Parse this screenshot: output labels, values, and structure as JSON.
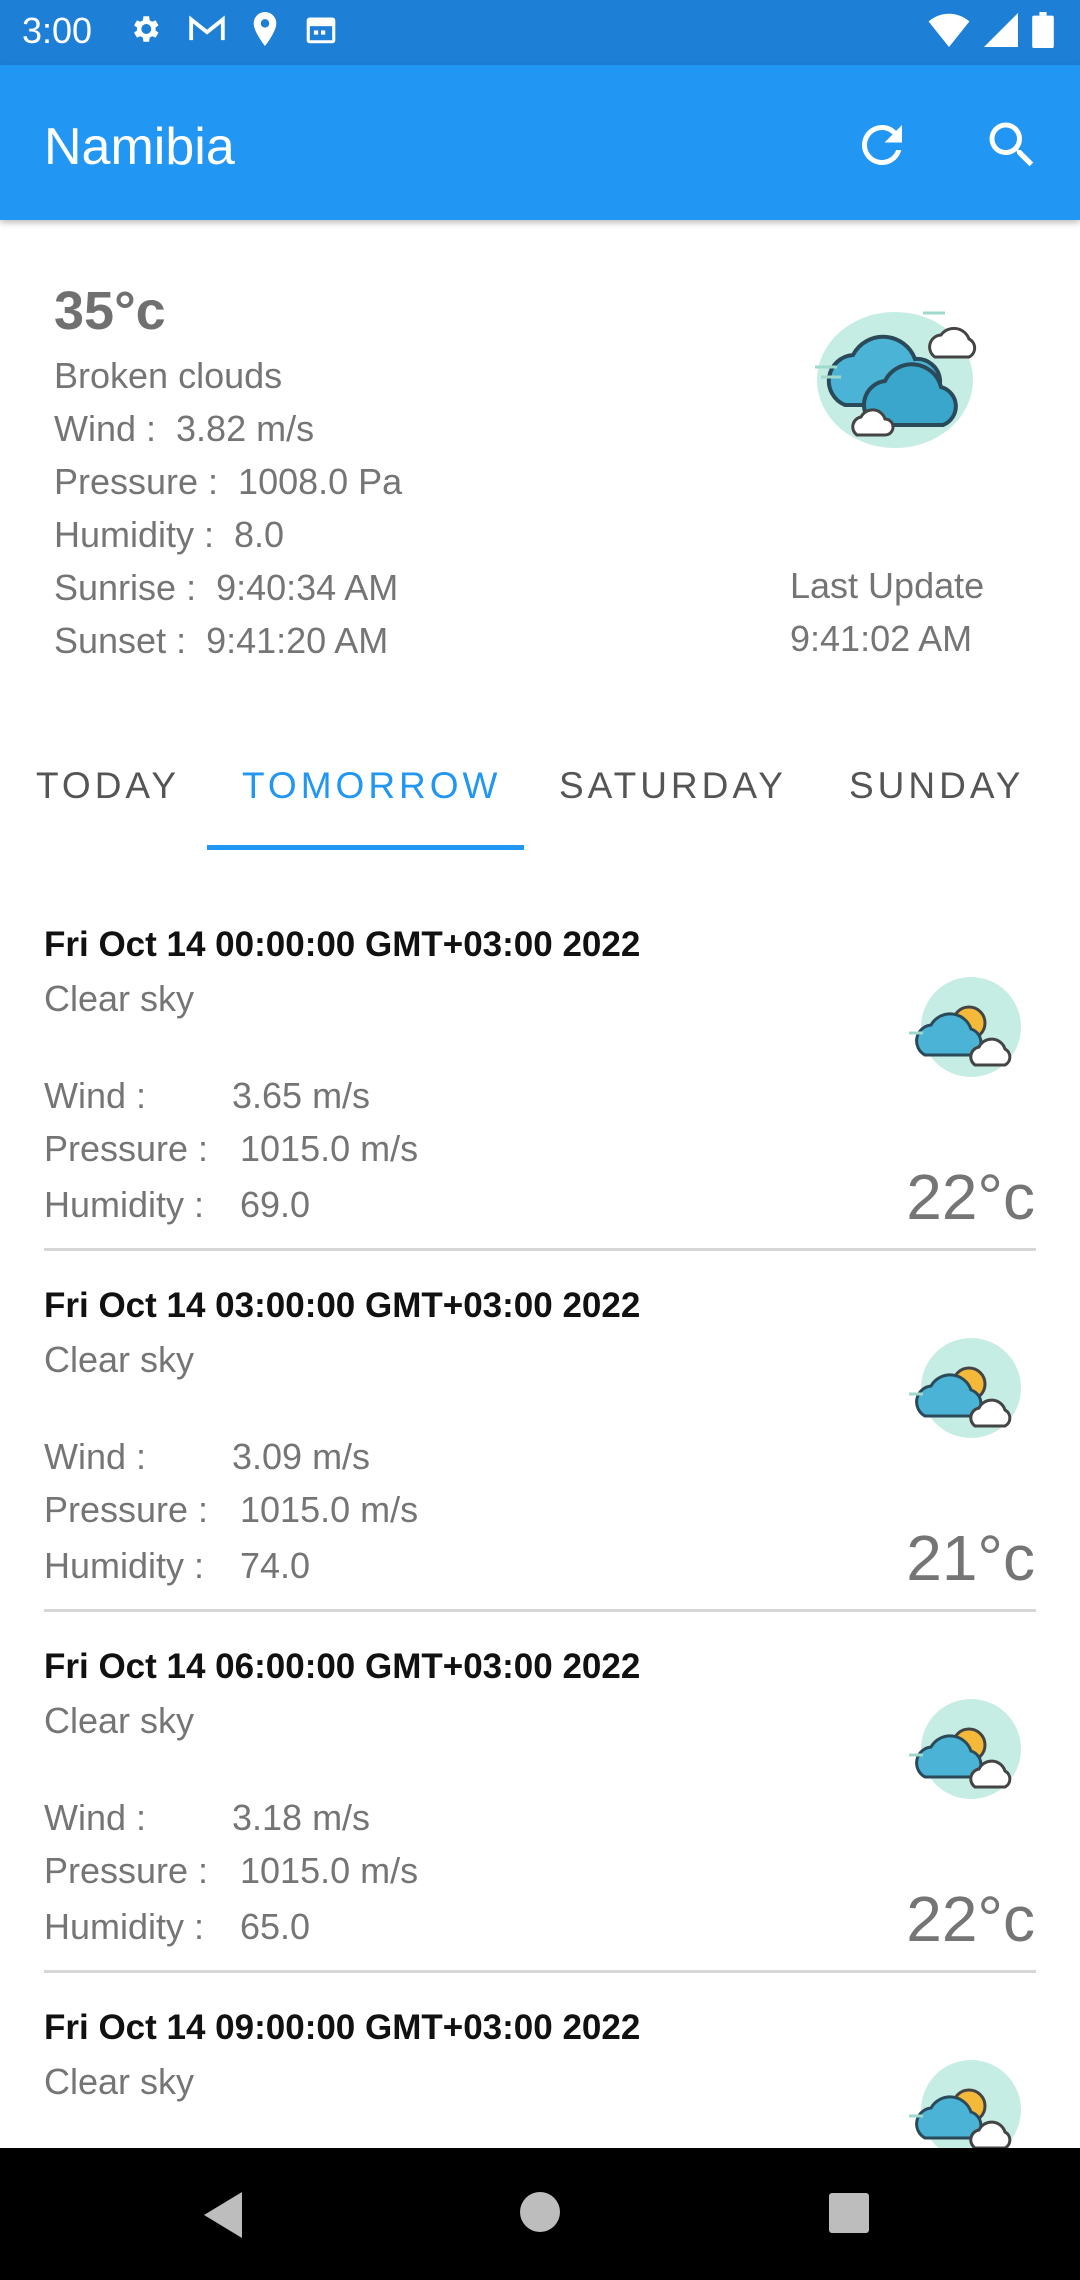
{
  "status_bar": {
    "time": "3:00",
    "icons_left": [
      "settings-icon",
      "gmail-icon",
      "location-icon",
      "calendar-icon"
    ],
    "icons_right": [
      "wifi-icon",
      "signal-icon",
      "battery-icon"
    ]
  },
  "app_bar": {
    "title": "Namibia",
    "actions": [
      "refresh-icon",
      "search-icon"
    ],
    "color": "#2196f3"
  },
  "current": {
    "temperature": "35°c",
    "description": "Broken clouds",
    "wind": "Wind :  3.82 m/s",
    "pressure": "Pressure :  1008.0 Pa",
    "humidity": "Humidity :  8.0",
    "sunrise": "Sunrise :  9:40:34 AM",
    "sunset": "Sunset :  9:41:20 AM",
    "last_update_label": "Last Update",
    "last_update_time": "9:41:02 AM",
    "icon": "broken-clouds-icon"
  },
  "tabs": [
    {
      "label": "TODAY",
      "active": false
    },
    {
      "label": "TOMORROW",
      "active": true
    },
    {
      "label": "SATURDAY",
      "active": false
    },
    {
      "label": "SUNDAY",
      "active": false
    }
  ],
  "forecast": [
    {
      "date": "Fri Oct 14 00:00:00 GMT+03:00 2022",
      "description": "Clear sky",
      "wind_label": "Wind :",
      "wind": "3.65 m/s",
      "pressure_label": "Pressure :",
      "pressure": "1015.0 m/s",
      "humidity_label": "Humidity :",
      "humidity": "69.0",
      "temperature": "22°c",
      "icon": "partly-cloudy-icon"
    },
    {
      "date": "Fri Oct 14 03:00:00 GMT+03:00 2022",
      "description": "Clear sky",
      "wind_label": "Wind :",
      "wind": "3.09 m/s",
      "pressure_label": "Pressure :",
      "pressure": "1015.0 m/s",
      "humidity_label": "Humidity :",
      "humidity": "74.0",
      "temperature": "21°c",
      "icon": "partly-cloudy-icon"
    },
    {
      "date": "Fri Oct 14 06:00:00 GMT+03:00 2022",
      "description": "Clear sky",
      "wind_label": "Wind :",
      "wind": "3.18 m/s",
      "pressure_label": "Pressure :",
      "pressure": "1015.0 m/s",
      "humidity_label": "Humidity :",
      "humidity": "65.0",
      "temperature": "22°c",
      "icon": "partly-cloudy-icon"
    },
    {
      "date": "Fri Oct 14 09:00:00 GMT+03:00 2022",
      "description": "Clear sky",
      "icon": "partly-cloudy-icon"
    }
  ],
  "nav_bar": {
    "buttons": [
      "back-icon",
      "home-icon",
      "recents-icon"
    ]
  }
}
